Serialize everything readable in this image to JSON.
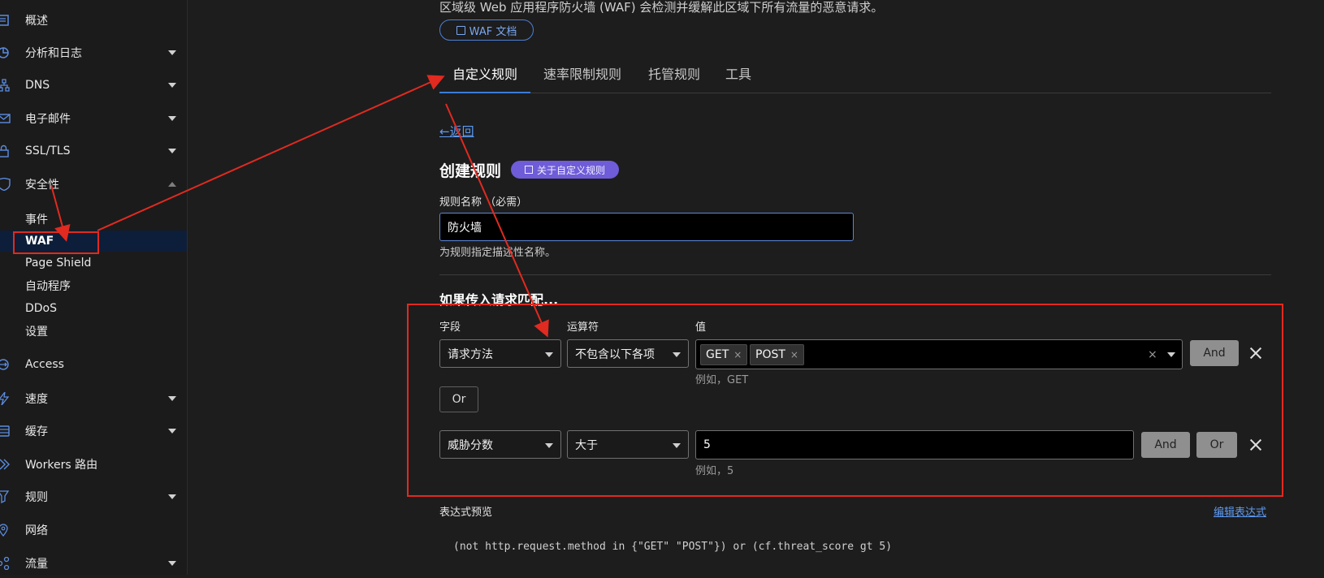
{
  "sidebar": {
    "items": [
      {
        "id": "overview",
        "label": "概述",
        "icon": "document-icon",
        "caret": "none"
      },
      {
        "id": "analytics",
        "label": "分析和日志",
        "icon": "pie-chart-icon",
        "caret": "down"
      },
      {
        "id": "dns",
        "label": "DNS",
        "icon": "network-icon",
        "caret": "down"
      },
      {
        "id": "email",
        "label": "电子邮件",
        "icon": "mail-icon",
        "caret": "down"
      },
      {
        "id": "ssl",
        "label": "SSL/TLS",
        "icon": "lock-icon",
        "caret": "down"
      },
      {
        "id": "security",
        "label": "安全性",
        "icon": "shield-icon",
        "caret": "up"
      }
    ],
    "security_sub": [
      {
        "id": "events",
        "label": "事件",
        "active": false
      },
      {
        "id": "waf",
        "label": "WAF",
        "active": true
      },
      {
        "id": "page-shield",
        "label": "Page Shield",
        "active": false
      },
      {
        "id": "bots",
        "label": "自动程序",
        "active": false
      },
      {
        "id": "ddos",
        "label": "DDoS",
        "active": false
      },
      {
        "id": "settings",
        "label": "设置",
        "active": false
      }
    ],
    "items2": [
      {
        "id": "access",
        "label": "Access",
        "icon": "access-icon",
        "caret": "none"
      },
      {
        "id": "speed",
        "label": "速度",
        "icon": "lightning-icon",
        "caret": "down"
      },
      {
        "id": "cache",
        "label": "缓存",
        "icon": "storage-icon",
        "caret": "down"
      },
      {
        "id": "workers",
        "label": "Workers 路由",
        "icon": "workers-icon",
        "caret": "none"
      },
      {
        "id": "rules",
        "label": "规则",
        "icon": "filter-icon",
        "caret": "down"
      },
      {
        "id": "network",
        "label": "网络",
        "icon": "location-icon",
        "caret": "none"
      },
      {
        "id": "traffic",
        "label": "流量",
        "icon": "traffic-icon",
        "caret": "down"
      }
    ]
  },
  "header": {
    "description": "区域级 Web 应用程序防火墙 (WAF) 会检测并缓解此区域下所有流量的恶意请求。",
    "docs_button": "WAF 文档"
  },
  "tabs": [
    {
      "label": "自定义规则",
      "active": true
    },
    {
      "label": "速率限制规则",
      "active": false
    },
    {
      "label": "托管规则",
      "active": false
    },
    {
      "label": "工具",
      "active": false
    }
  ],
  "back_link": {
    "arrow": "←",
    "label": "返回"
  },
  "create": {
    "title": "创建规则",
    "badge": "关于自定义规则",
    "name_label": "规则名称 （必需）",
    "name_value": "防火墙",
    "name_help": "为规则指定描述性名称。"
  },
  "conditions": {
    "heading": "如果传入请求匹配...",
    "headers": {
      "field": "字段",
      "operator": "运算符",
      "value": "值"
    },
    "row1": {
      "field": "请求方法",
      "operator": "不包含以下各项",
      "chips": [
        "GET",
        "POST"
      ],
      "hint": "例如，GET",
      "and_label": "And"
    },
    "or_label": "Or",
    "row2": {
      "field": "威胁分数",
      "operator": "大于",
      "value": "5",
      "hint": "例如，5",
      "and_label": "And",
      "or_label": "Or"
    }
  },
  "expression": {
    "label": "表达式预览",
    "edit_link": "编辑表达式",
    "code": "(not http.request.method in {\"GET\" \"POST\"}) or (cf.threat_score gt 5)"
  },
  "annotation": {
    "color": "#e12a20"
  }
}
